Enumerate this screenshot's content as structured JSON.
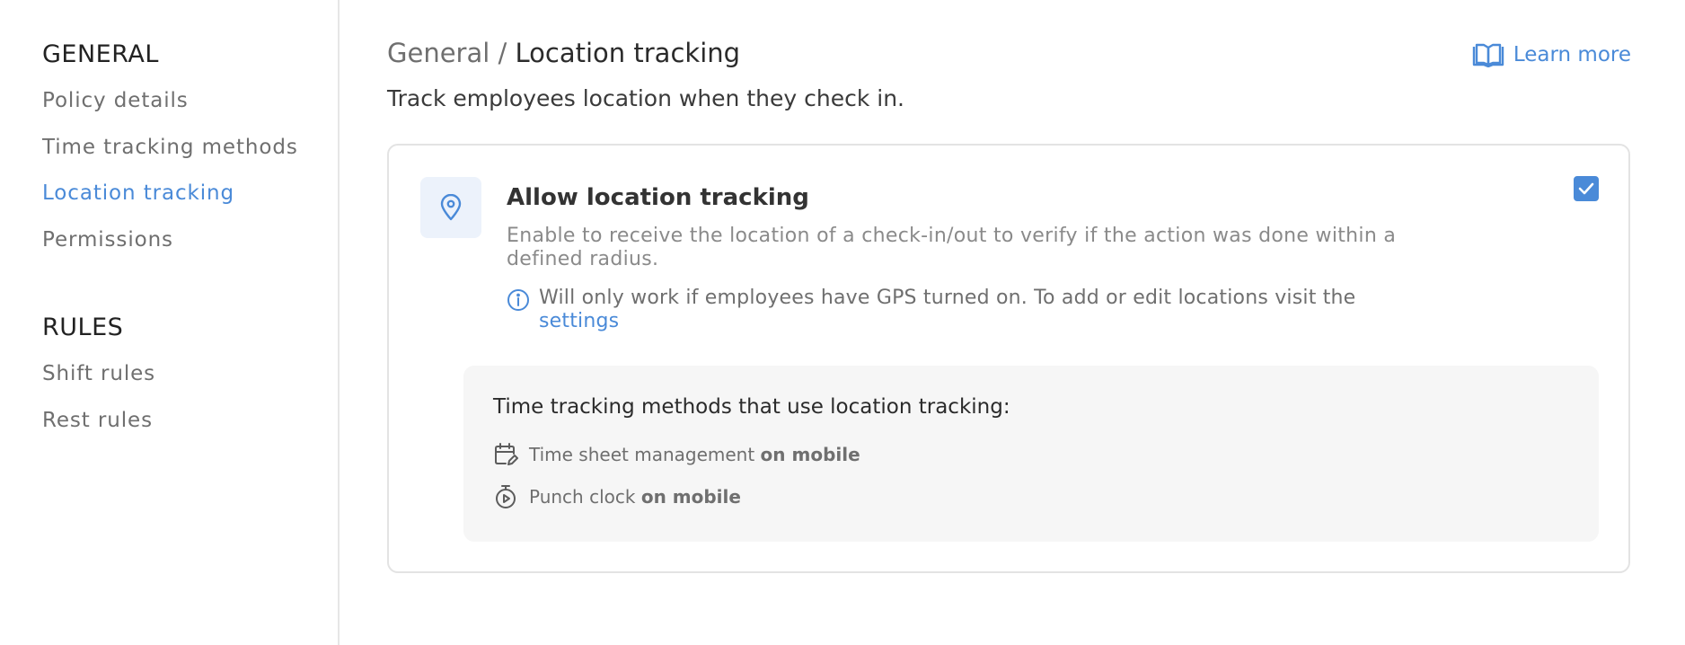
{
  "sidebar": {
    "general_title": "GENERAL",
    "general_items": [
      {
        "label": "Policy details",
        "active": false
      },
      {
        "label": "Time tracking methods",
        "active": false
      },
      {
        "label": "Location tracking",
        "active": true
      },
      {
        "label": "Permissions",
        "active": false
      }
    ],
    "rules_title": "RULES",
    "rules_items": [
      {
        "label": "Shift rules"
      },
      {
        "label": "Rest rules"
      }
    ]
  },
  "header": {
    "breadcrumb_parent": "General",
    "breadcrumb_separator": " / ",
    "breadcrumb_current": "Location tracking",
    "learn_more_label": "Learn more",
    "learn_more_icon": "book-open-icon",
    "subtitle": "Track employees location when they check in."
  },
  "card": {
    "icon": "map-pin-icon",
    "title": "Allow location tracking",
    "description": "Enable to receive the location of a check-in/out to verify if the action was done within a defined radius.",
    "info_icon": "info-icon",
    "info_text": "Will only work if employees have GPS turned on. To add or edit locations visit the ",
    "info_link": "settings",
    "checked": true,
    "methods_title": "Time tracking methods that use location tracking:",
    "methods": [
      {
        "icon": "calendar-edit-icon",
        "text": "Time sheet management ",
        "emphasis": "on mobile"
      },
      {
        "icon": "stopwatch-play-icon",
        "text": "Punch clock ",
        "emphasis": "on mobile"
      }
    ]
  },
  "colors": {
    "accent": "#4a8ad8",
    "muted_text": "#6f6f6f",
    "panel_bg": "#f6f6f6",
    "icon_bg": "#ecf2fb"
  }
}
